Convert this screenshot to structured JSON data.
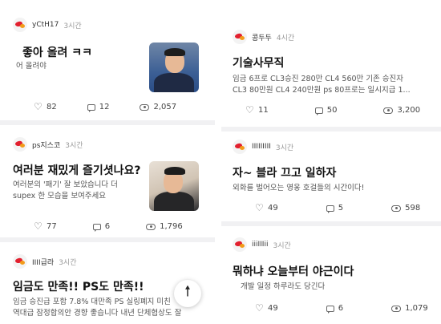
{
  "left_posts": [
    {
      "author": "yCtH17",
      "time": "3시간",
      "title": "좋아 올려 ㅋㅋ",
      "body": [
        "어 올려야"
      ],
      "likes": "82",
      "comments": "12",
      "views": "2,057",
      "thumbnail": "person-photo"
    },
    {
      "author": "ps지스코",
      "time": "3시간",
      "title": "여러분 재밌게 즐기셧나요?",
      "body": [
        "여러분의 '패기' 잘 보았습니다 더",
        "supex 한 모습을 보여주세요"
      ],
      "likes": "77",
      "comments": "6",
      "views": "1,796",
      "thumbnail": "person-photo"
    },
    {
      "author": "IIII급라",
      "time": "3시간",
      "title": "임금도 만족!! PS도 만족!!",
      "body": [
        "임금 승진급 포함 7.8% 대만족 PS 실링폐지 미친",
        "역대급 잠정합의안 경향 좋습니다 내년 단체협상도 잘"
      ]
    }
  ],
  "right_posts": [
    {
      "author": "콩두두",
      "time": "4시간",
      "title": "기술사무직",
      "body": [
        "임금 6프로 CL3승진 280만 CL4 560만 기존 승진자",
        "CL3 80만원 CL4 240만원 ps 80프로는 일시지급 1..."
      ],
      "likes": "11",
      "comments": "50",
      "views": "3,200"
    },
    {
      "author": "IIIIIIIII",
      "time": "3시간",
      "title": "자~ 블라 끄고 일하자",
      "body": [
        "외화를 벌어오는 영웅 호걸들의 시간이다!"
      ],
      "likes": "49",
      "comments": "5",
      "views": "598"
    },
    {
      "author": "iiiIIIii",
      "time": "3시간",
      "title": "뭐하냐 오늘부터 야근이다",
      "body": [
        "개발 일정 하루라도 당긴다"
      ],
      "likes": "49",
      "comments": "6",
      "views": "1,079"
    }
  ],
  "fab_icon": "arrow-up-icon",
  "colors": {
    "divider": "#f1f1f3",
    "brand_red": "#e2202f",
    "brand_orange": "#f29b1a"
  }
}
